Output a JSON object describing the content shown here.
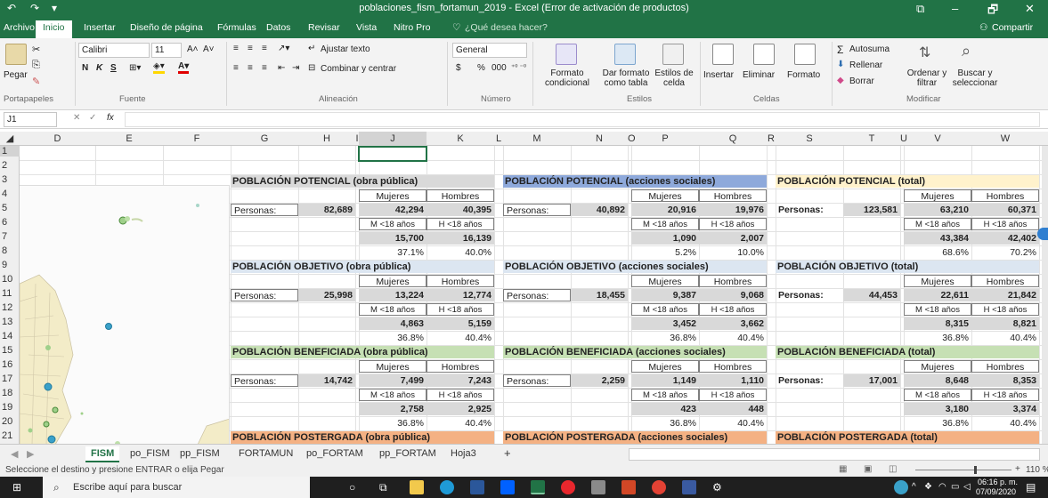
{
  "window": {
    "title": "poblaciones_fism_fortamun_2019 - Excel (Error de activación de productos)",
    "minimize": "–",
    "maximize": "🗗",
    "close": "✕",
    "ribbon_display": "⧉"
  },
  "quick_access": {
    "save": "↶",
    "undo": "↷",
    "customize": "▾"
  },
  "ribbon_tabs": [
    "Archivo",
    "Inicio",
    "Insertar",
    "Diseño de página",
    "Fórmulas",
    "Datos",
    "Revisar",
    "Vista",
    "Nitro Pro"
  ],
  "tell_me": "¿Qué desea hacer?",
  "share": "Compartir",
  "ribbon": {
    "paste": "Pegar",
    "font_name": "Calibri",
    "font_size": "11",
    "bold": "N",
    "italic": "K",
    "underline": "S",
    "wrap_text": "Ajustar texto",
    "merge_center": "Combinar y centrar",
    "number_format": "General",
    "currency": "$",
    "percent": "%",
    "thousands": "000",
    "cond_format": "Formato condicional",
    "format_table": "Dar formato como tabla",
    "cell_styles": "Estilos de celda",
    "insert": "Insertar",
    "delete": "Eliminar",
    "format": "Formato",
    "autosum": "Autosuma",
    "fill": "Rellenar",
    "clear": "Borrar",
    "sort_filter": "Ordenar y filtrar",
    "find_select": "Buscar y seleccionar",
    "groups": [
      "Portapapeles",
      "Fuente",
      "Alineación",
      "Número",
      "Estilos",
      "Celdas",
      "Modificar"
    ]
  },
  "formula_bar": {
    "name_box": "J1",
    "fx": "fx",
    "value": ""
  },
  "columns": [
    "D",
    "E",
    "F",
    "G",
    "H",
    "I",
    "J",
    "K",
    "L",
    "M",
    "N",
    "O",
    "P",
    "Q",
    "R",
    "S",
    "T",
    "U",
    "V",
    "W"
  ],
  "rows": [
    "1",
    "2",
    "3",
    "4",
    "5",
    "6",
    "7",
    "8",
    "9",
    "10",
    "11",
    "12",
    "13",
    "14",
    "15",
    "16",
    "17",
    "18",
    "19",
    "20",
    "21"
  ],
  "labels": {
    "personas": "Personas:",
    "mujeres": "Mujeres",
    "hombres": "Hombres",
    "m18": "M <18 años",
    "h18": "H <18 años"
  },
  "sections": [
    {
      "row": 3,
      "title": "POBLACIÓN POTENCIAL (obra pública)",
      "color": "#d9d9d9"
    },
    {
      "row": 3,
      "title": "POBLACIÓN POTENCIAL (acciones sociales)",
      "color": "#8ea9db"
    },
    {
      "row": 3,
      "title": "POBLACIÓN POTENCIAL (total)",
      "color": "#fff2cc"
    },
    {
      "row": 9,
      "title": "POBLACIÓN OBJETIVO (obra pública)",
      "color": "#dce6f1"
    },
    {
      "row": 9,
      "title": "POBLACIÓN OBJETIVO (acciones sociales)",
      "color": "#dce6f1"
    },
    {
      "row": 9,
      "title": "POBLACIÓN OBJETIVO (total)",
      "color": "#dce6f1"
    },
    {
      "row": 15,
      "title": "POBLACIÓN BENEFICIADA (obra pública)",
      "color": "#c6e0b4"
    },
    {
      "row": 15,
      "title": "POBLACIÓN BENEFICIADA (acciones sociales)",
      "color": "#c6e0b4"
    },
    {
      "row": 15,
      "title": "POBLACIÓN BENEFICIADA (total)",
      "color": "#c6e0b4"
    },
    {
      "row": 21,
      "title": "POBLACIÓN POSTERGADA (obra pública)",
      "color": "#f4b183"
    },
    {
      "row": 21,
      "title": "POBLACIÓN POSTERGADA (acciones sociales)",
      "color": "#f4b183"
    },
    {
      "row": 21,
      "title": "POBLACIÓN POSTERGADA (total)",
      "color": "#f4b183"
    }
  ],
  "blocks": [
    {
      "personas": "82,689",
      "mujeres": "42,294",
      "hombres": "40,395",
      "m18": "15,700",
      "h18": "16,139",
      "pm": "37.1%",
      "ph": "40.0%"
    },
    {
      "personas": "40,892",
      "mujeres": "20,916",
      "hombres": "19,976",
      "m18": "1,090",
      "h18": "2,007",
      "pm": "5.2%",
      "ph": "10.0%"
    },
    {
      "personas": "123,581",
      "mujeres": "63,210",
      "hombres": "60,371",
      "m18": "43,384",
      "h18": "42,402",
      "pm": "68.6%",
      "ph": "70.2%"
    },
    {
      "personas": "25,998",
      "mujeres": "13,224",
      "hombres": "12,774",
      "m18": "4,863",
      "h18": "5,159",
      "pm": "36.8%",
      "ph": "40.4%"
    },
    {
      "personas": "18,455",
      "mujeres": "9,387",
      "hombres": "9,068",
      "m18": "3,452",
      "h18": "3,662",
      "pm": "36.8%",
      "ph": "40.4%"
    },
    {
      "personas": "44,453",
      "mujeres": "22,611",
      "hombres": "21,842",
      "m18": "8,315",
      "h18": "8,821",
      "pm": "36.8%",
      "ph": "40.4%"
    },
    {
      "personas": "14,742",
      "mujeres": "7,499",
      "hombres": "7,243",
      "m18": "2,758",
      "h18": "2,925",
      "pm": "36.8%",
      "ph": "40.4%"
    },
    {
      "personas": "2,259",
      "mujeres": "1,149",
      "hombres": "1,110",
      "m18": "423",
      "h18": "448",
      "pm": "36.8%",
      "ph": "40.4%"
    },
    {
      "personas": "17,001",
      "mujeres": "8,648",
      "hombres": "8,353",
      "m18": "3,180",
      "h18": "3,374",
      "pm": "36.8%",
      "ph": "40.4%"
    }
  ],
  "sheet_tabs": [
    "FISM",
    "po_FISM",
    "pp_FISM",
    "FORTAMUN",
    "po_FORTAM",
    "pp_FORTAM",
    "Hoja3"
  ],
  "add_sheet": "+",
  "status": {
    "message": "Seleccione el destino y presione ENTRAR o elija Pegar",
    "zoom": "110 %"
  },
  "taskbar": {
    "search": "Escribe aquí para buscar",
    "time": "06:16 p. m.",
    "date": "07/09/2020"
  }
}
